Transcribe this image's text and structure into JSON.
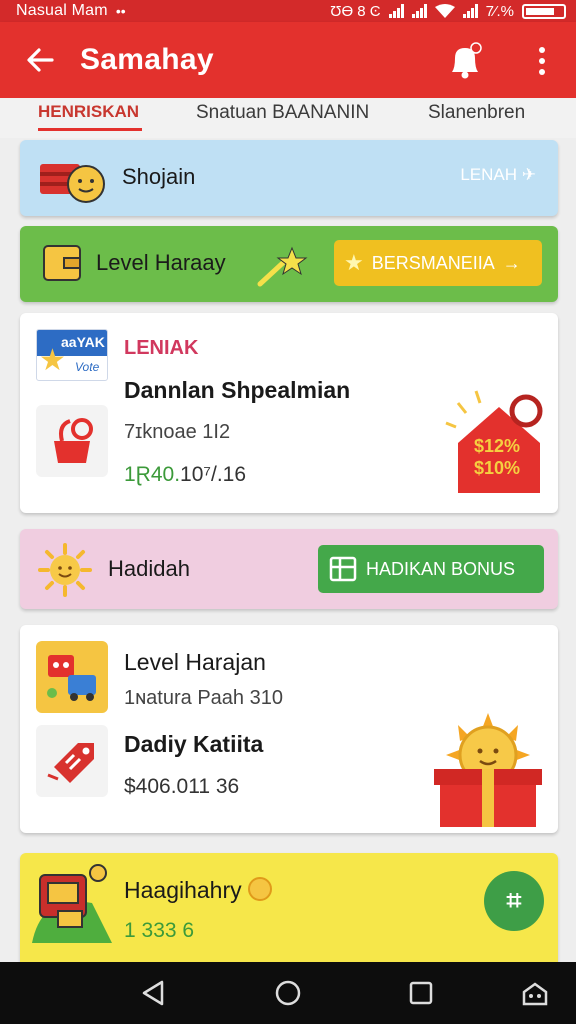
{
  "status_bar": {
    "carrier": "Nasual Mam",
    "dots": "••",
    "icons": "ƱƟ 8 Ͼ",
    "battery": "7⁄.%"
  },
  "app_bar": {
    "title": "Samahay",
    "back_icon": "arrow-left-icon",
    "bell_icon": "bell-icon",
    "menu_icon": "more-vert-icon"
  },
  "tabs": [
    {
      "label": "HENRISKAN",
      "active": true
    },
    {
      "label": "Snatuan BAANANIN",
      "active": false
    },
    {
      "label": "Slanenbren",
      "active": false
    }
  ],
  "banner_blue": {
    "label": "Shojain",
    "link": "LENAH"
  },
  "banner_green": {
    "label": "Level Haraay",
    "button": "BERSMANEIIA"
  },
  "card1": {
    "badge_top": "aaYAK",
    "badge_bottom": "Vote",
    "tag": "LENIAK",
    "title": "Dannlan Shpealmian",
    "subtitle": "7ɪknoae 1I2",
    "amount_green": "1Ɽ40.",
    "amount_rest": "10⁷/.16",
    "sale_line1": "$12%",
    "sale_line2": "$10%"
  },
  "banner_pink": {
    "label": "Hadidah",
    "button": "HADIKAN BONUS"
  },
  "card2": {
    "title": "Level Harajan",
    "subtitle": "1ɴatura Paah 310",
    "item_title": "Dadiy Katiita",
    "amount": "$406.011 36"
  },
  "card3": {
    "title": "Haagihahry",
    "amount": "1 333 6"
  },
  "colors": {
    "primary": "#e3312d",
    "green": "#44a84a",
    "yellow": "#f0c020",
    "blue_banner": "#bfe0f4",
    "pink_banner": "#f0cde0"
  }
}
